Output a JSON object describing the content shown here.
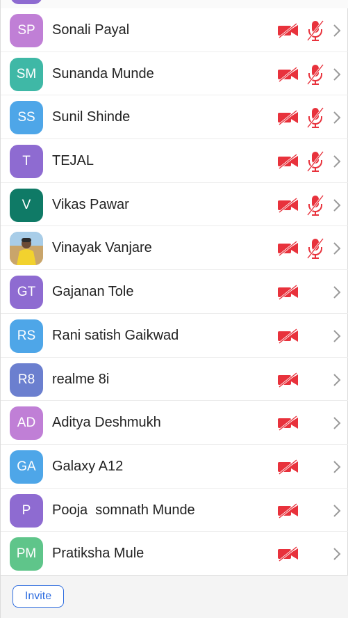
{
  "participants": [
    {
      "initials": "SP",
      "name": "Sonali Payal",
      "color": "#c07fd6",
      "mic_muted": true,
      "video_off": true
    },
    {
      "initials": "SM",
      "name": "Sunanda Munde",
      "color": "#3fb8a6",
      "mic_muted": true,
      "video_off": true
    },
    {
      "initials": "SS",
      "name": "Sunil Shinde",
      "color": "#4ea6e8",
      "mic_muted": true,
      "video_off": true
    },
    {
      "initials": "T",
      "name": "TEJAL",
      "color": "#8e6bd1",
      "mic_muted": true,
      "video_off": true
    },
    {
      "initials": "V",
      "name": "Vikas Pawar",
      "color": "#0f7a66",
      "mic_muted": true,
      "video_off": true
    },
    {
      "initials": "",
      "name": "Vinayak Vanjare",
      "color": "#d9b27a",
      "photo": true,
      "mic_muted": true,
      "video_off": true
    },
    {
      "initials": "GT",
      "name": "Gajanan Tole",
      "color": "#8e6bd1",
      "mic_muted": false,
      "video_off": true
    },
    {
      "initials": "RS",
      "name": "Rani satish Gaikwad",
      "color": "#4ea6e8",
      "mic_muted": false,
      "video_off": true
    },
    {
      "initials": "R8",
      "name": "realme 8i",
      "color": "#6b7fcf",
      "mic_muted": false,
      "video_off": true
    },
    {
      "initials": "AD",
      "name": "Aditya Deshmukh",
      "color": "#c07fd6",
      "mic_muted": false,
      "video_off": true
    },
    {
      "initials": "GA",
      "name": "Galaxy A12",
      "color": "#4ea6e8",
      "mic_muted": false,
      "video_off": true
    },
    {
      "initials": "P",
      "name": "Pooja  somnath Munde",
      "color": "#8e6bd1",
      "mic_muted": false,
      "video_off": true
    },
    {
      "initials": "PM",
      "name": "Pratiksha Mule",
      "color": "#5fc58a",
      "mic_muted": false,
      "video_off": true
    }
  ],
  "footer": {
    "invite_label": "Invite"
  },
  "icons": {
    "camera": "video-off-icon",
    "mic": "mic-off-icon",
    "chevron": "chevron-right-icon"
  },
  "colors": {
    "muted_red": "#e8323c",
    "invite_blue": "#2d6cdf"
  }
}
